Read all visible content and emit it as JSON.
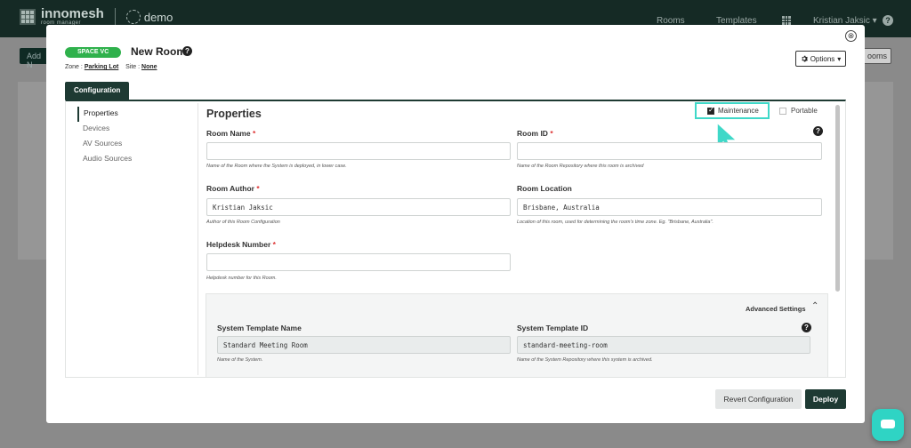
{
  "topbar": {
    "brand": "innomesh",
    "brand_sub": "room manager",
    "tenant": "demo",
    "nav_rooms": "Rooms",
    "nav_templates": "Templates",
    "user": "Kristian Jaksic ▾",
    "help": "?"
  },
  "background": {
    "left_button": "Add N",
    "right_button": "ooms"
  },
  "modal": {
    "badge": "SPACE VC",
    "title": "New Room",
    "zone_label": "Zone :",
    "zone_value": "Parking Lot",
    "site_label": "Site :",
    "site_value": "None",
    "options_label": "Options",
    "close_icon": "⊗",
    "tab_label": "Configuration",
    "side_nav": [
      "Properties",
      "Devices",
      "AV Sources",
      "Audio Sources"
    ],
    "section_title": "Properties",
    "maintenance_label": "Maintenance",
    "maintenance_checked": true,
    "portable_label": "Portable",
    "portable_checked": false,
    "fields": {
      "room_name": {
        "label": "Room Name",
        "required": "*",
        "value": "",
        "hint": "Name of the Room where the System is deployed, in lower case."
      },
      "room_id": {
        "label": "Room ID",
        "required": "*",
        "value": "",
        "hint": "Name of the Room Repository where this room is archived"
      },
      "room_author": {
        "label": "Room Author",
        "required": "*",
        "value": "Kristian Jaksic",
        "hint": "Author of this Room Configuration"
      },
      "room_location": {
        "label": "Room Location",
        "value": "Brisbane, Australia",
        "hint": "Location of this room, used for determining the room's time zone. Eg. \"Brisbane, Australia\"."
      },
      "helpdesk_number": {
        "label": "Helpdesk Number",
        "required": "*",
        "value": "",
        "hint": "Helpdesk number for this Room."
      }
    },
    "advanced": {
      "toggle_label": "Advanced Settings",
      "chevron": "⌃",
      "template_name": {
        "label": "System Template Name",
        "value": "Standard Meeting Room",
        "hint": "Name of the System."
      },
      "template_id": {
        "label": "System Template ID",
        "value": "standard-meeting-room",
        "hint": "Name of the System Repository where this system is archived."
      }
    },
    "buttons": {
      "revert": "Revert Configuration",
      "deploy": "Deploy"
    }
  },
  "colors": {
    "brand_dark": "#1e3a33",
    "badge_green": "#2fb14c",
    "highlight_cyan": "#3fd8c8",
    "required_red": "#d33333"
  },
  "icons": {
    "help": "help-circle-icon",
    "gear": "gear-icon",
    "close": "close-circle-icon",
    "cursor": "pointer-cursor-icon",
    "apps": "apps-grid-icon",
    "chat": "chat-icon"
  }
}
